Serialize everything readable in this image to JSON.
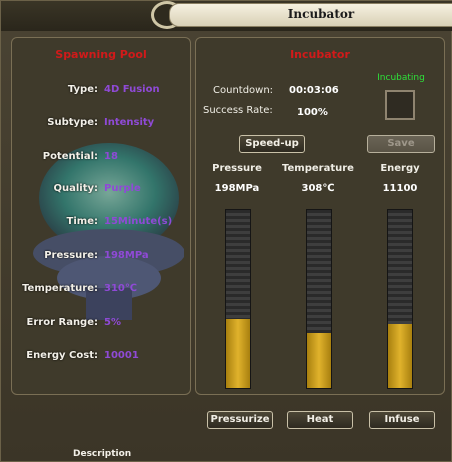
{
  "window": {
    "title": "Incubator"
  },
  "left": {
    "title": "Spawning Pool",
    "rows": [
      {
        "label": "Type:",
        "value": "4D Fusion"
      },
      {
        "label": "Subtype:",
        "value": "Intensity"
      },
      {
        "label": "Potential:",
        "value": "18"
      },
      {
        "label": "Quality:",
        "value": "Purple"
      },
      {
        "label": "Time:",
        "value": "15Minute(s)"
      },
      {
        "label": "Pressure:",
        "value": "198MPa"
      },
      {
        "label": "Temperature:",
        "value": "310℃"
      },
      {
        "label": "Error Range:",
        "value": "5%"
      },
      {
        "label": "Energy Cost:",
        "value": "10001"
      }
    ]
  },
  "right": {
    "title": "Incubator",
    "countdown_label": "Countdown:",
    "countdown_value": "00:03:06",
    "success_label": "Success Rate:",
    "success_value": "100%",
    "status": "Incubating",
    "speedup_label": "Speed-up",
    "save_label": "Save",
    "columns": [
      {
        "label": "Pressure",
        "value": "198MPa",
        "fill": 0.39
      },
      {
        "label": "Temperature",
        "value": "308℃",
        "fill": 0.31
      },
      {
        "label": "Energy",
        "value": "11100",
        "fill": 0.36
      }
    ]
  },
  "actions": {
    "pressurize_label": "Pressurize",
    "heat_label": "Heat",
    "infuse_label": "Infuse"
  },
  "footer": {
    "description_label": "Description"
  }
}
